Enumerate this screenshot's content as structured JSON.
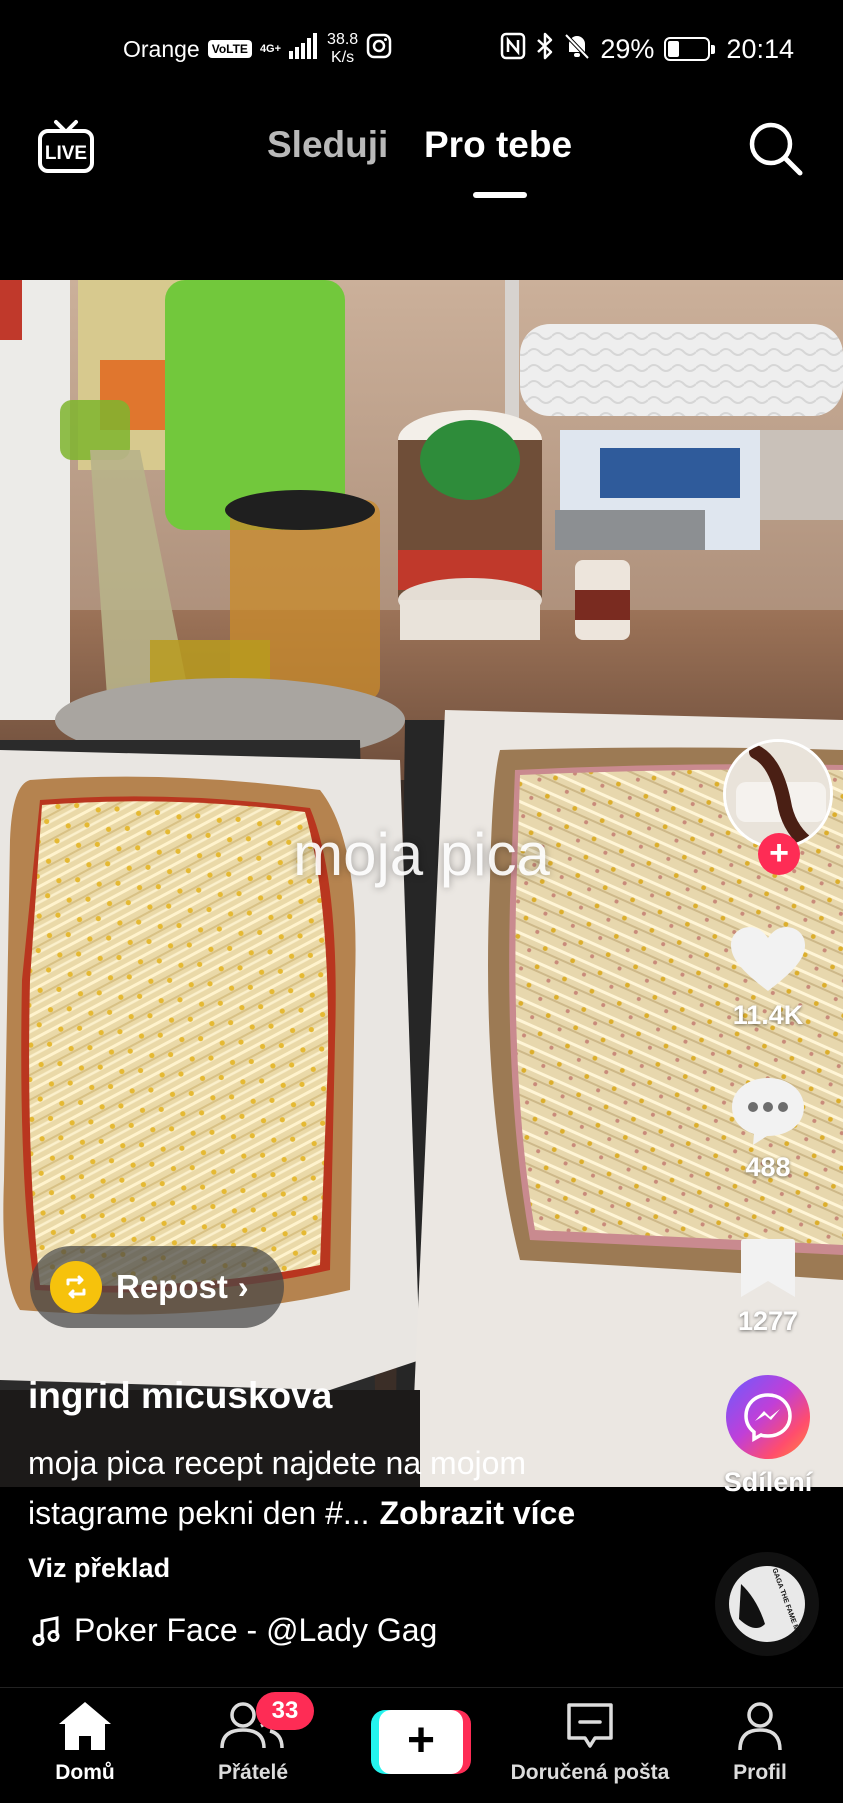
{
  "status_bar": {
    "carrier": "Orange",
    "volte": "VoLTE",
    "network": "4G+",
    "speed_value": "38.8",
    "speed_unit": "K/s",
    "battery_percent": "29%",
    "battery_level": 0.29,
    "time": "20:14"
  },
  "top_nav": {
    "live_label": "LIVE",
    "tab_following": "Sleduji",
    "tab_for_you": "Pro tebe",
    "active_tab": "Pro tebe"
  },
  "video": {
    "overlay_text": "moja pica"
  },
  "actions": {
    "likes": "11.4K",
    "comments": "488",
    "bookmarks": "1277",
    "share_label": "Sdílení"
  },
  "repost": {
    "label": "Repost"
  },
  "post": {
    "username": "ingrid micuskova",
    "caption": "moja pica recept najdete na mojom istagrame pekni den #...",
    "see_more": "Zobrazit více",
    "translate": "Viz překlad",
    "sound": "Poker Face - @Lady Gag",
    "disc_text": "LADY GAGA THE FAME MONSTER"
  },
  "bottom_nav": {
    "home": "Domů",
    "friends": "Přátelé",
    "friends_badge": "33",
    "inbox": "Doručená pošta",
    "profile": "Profil"
  },
  "colors": {
    "accent_red": "#fe2c55",
    "accent_cyan": "#25f4ee",
    "repost_yellow": "#f6c20c"
  }
}
